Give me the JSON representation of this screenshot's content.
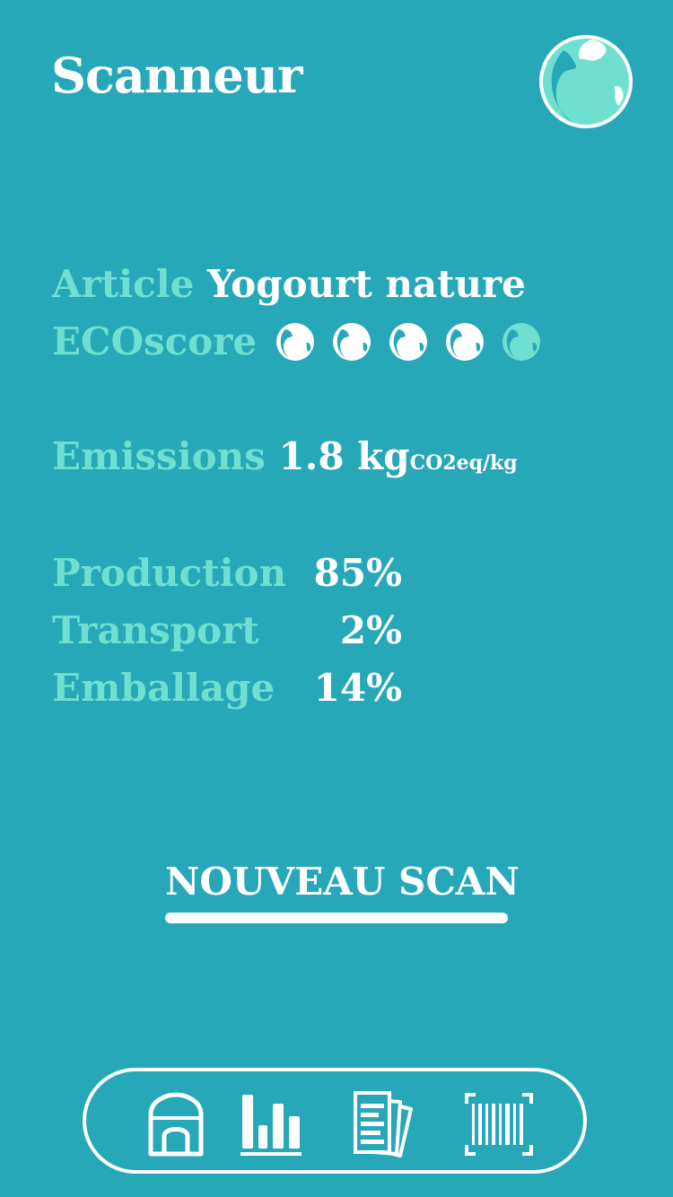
{
  "header": {
    "title": "Scanneur",
    "globe_icon": "globe-icon"
  },
  "product": {
    "article_label": "Article",
    "article_value": "Yogourt nature",
    "ecoscore_label": "ECOscore",
    "ecoscore_value": 4,
    "ecoscore_max": 5,
    "emissions_label": "Emissions",
    "emissions_value": "1.8 kg",
    "emissions_unit": "CO2eq/kg"
  },
  "breakdown": [
    {
      "label": "Production",
      "value": "85%"
    },
    {
      "label": "Transport",
      "value": "2%"
    },
    {
      "label": "Emballage",
      "value": "14%"
    }
  ],
  "action": {
    "new_scan_label": "NOUVEAU SCAN"
  },
  "nav": {
    "items": [
      "home-icon",
      "bar-chart-icon",
      "documents-icon",
      "barcode-scanner-icon"
    ],
    "active": "bar-chart-icon"
  },
  "colors": {
    "background": "#26a8b8",
    "accent": "#6fe0d0",
    "text": "#ffffff"
  }
}
